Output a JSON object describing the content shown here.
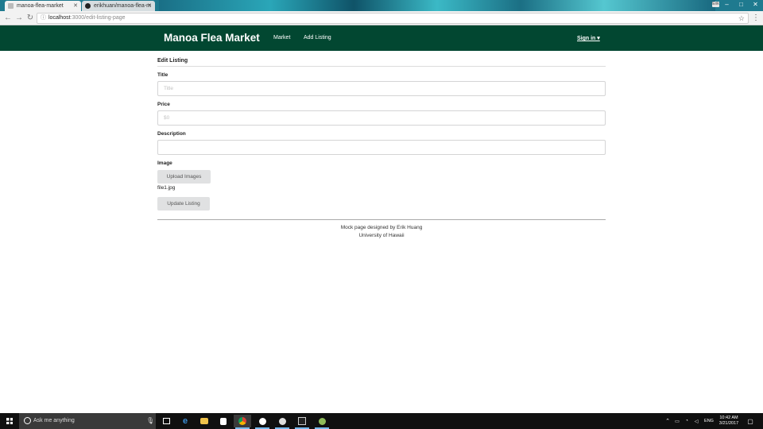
{
  "browser": {
    "tabs": [
      {
        "title": "manoa-flea-market",
        "icon": "page-icon"
      },
      {
        "title": "erikhuan/manoa-flea-m",
        "icon": "github-icon"
      }
    ],
    "profile_label": "Erik",
    "address": {
      "host": "localhost",
      "path": ":3000/edit-listing-page"
    }
  },
  "navbar": {
    "brand": "Manoa Flea Market",
    "links": [
      "Market",
      "Add Listing"
    ],
    "signin": "Sign in ▾",
    "color": "#024731"
  },
  "form": {
    "title": "Edit Listing",
    "title_label": "Title",
    "title_placeholder": "Title",
    "price_label": "Price",
    "price_placeholder": "$0",
    "description_label": "Description",
    "description_placeholder": "",
    "image_label": "Image",
    "upload_button": "Upload Images",
    "file_name": "file1.jpg",
    "submit_button": "Update Listing"
  },
  "footer": {
    "line1": "Mock page designed by Erik Huang",
    "line2": "University of Hawaii"
  },
  "taskbar": {
    "search_placeholder": "Ask me anything",
    "language": "ENG",
    "time": "10:42 AM",
    "date": "3/21/2017",
    "apps": [
      "task-view-icon",
      "edge-icon",
      "file-explorer-icon",
      "store-icon",
      "chrome-icon",
      "slack-icon",
      "twitch-icon",
      "terminal-icon",
      "atom-icon"
    ]
  }
}
